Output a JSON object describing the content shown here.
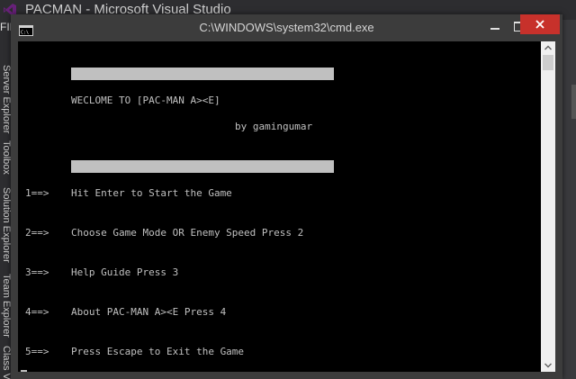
{
  "vs": {
    "title": "PACMAN - Microsoft Visual Studio",
    "menu_fragment": "FIL",
    "side_tabs": [
      "Server Explorer",
      "Toolbox",
      "Solution Explorer",
      "Team Explorer",
      "Class Vi"
    ]
  },
  "console": {
    "title": "C:\\WINDOWS\\system32\\cmd.exe",
    "lines": {
      "welcome": "WECLOME TO [PAC-MAN A><E]",
      "byline": "by gamingumar",
      "opt1_num": "1==>",
      "opt1_text": "Hit Enter to Start the Game",
      "opt2_num": "2==>",
      "opt2_text": "Choose Game Mode OR Enemy Speed Press 2",
      "opt3_num": "3==>",
      "opt3_text": "Help Guide Press 3",
      "opt4_num": "4==>",
      "opt4_text": "About PAC-MAN A><E Press 4",
      "opt5_num": "5==>",
      "opt5_text": "Press Escape to Exit the Game"
    }
  },
  "icons": {
    "vs_logo": "visual-studio-logo-icon",
    "console": "console-app-icon",
    "minimize": "minimize-icon",
    "maximize": "maximize-icon",
    "close": "close-icon",
    "scroll_up": "chevron-up-icon",
    "scroll_down": "chevron-down-icon"
  },
  "colors": {
    "vs_background": "#2d2d30",
    "vs_logo": "#68217a",
    "console_frame": "#3c3c3c",
    "console_background": "#000000",
    "console_text": "#c0c0c0",
    "close_button": "#c7312b",
    "scrollbar_track": "#f0f0f0"
  }
}
